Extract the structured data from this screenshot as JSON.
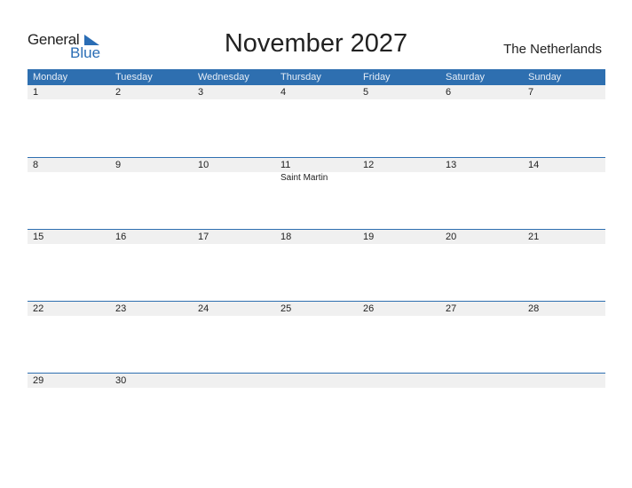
{
  "logo": {
    "general": "General",
    "blue": "Blue"
  },
  "title": "November 2027",
  "country": "The Netherlands",
  "days": [
    "Monday",
    "Tuesday",
    "Wednesday",
    "Thursday",
    "Friday",
    "Saturday",
    "Sunday"
  ],
  "weeks": [
    {
      "dates": [
        "1",
        "2",
        "3",
        "4",
        "5",
        "6",
        "7"
      ],
      "events": [
        "",
        "",
        "",
        "",
        "",
        "",
        ""
      ]
    },
    {
      "dates": [
        "8",
        "9",
        "10",
        "11",
        "12",
        "13",
        "14"
      ],
      "events": [
        "",
        "",
        "",
        "Saint Martin",
        "",
        "",
        ""
      ]
    },
    {
      "dates": [
        "15",
        "16",
        "17",
        "18",
        "19",
        "20",
        "21"
      ],
      "events": [
        "",
        "",
        "",
        "",
        "",
        "",
        ""
      ]
    },
    {
      "dates": [
        "22",
        "23",
        "24",
        "25",
        "26",
        "27",
        "28"
      ],
      "events": [
        "",
        "",
        "",
        "",
        "",
        "",
        ""
      ]
    },
    {
      "dates": [
        "29",
        "30",
        "",
        "",
        "",
        "",
        ""
      ],
      "events": [
        "",
        "",
        "",
        "",
        "",
        "",
        ""
      ]
    }
  ],
  "colors": {
    "accent": "#2e6fb0",
    "row_bg": "#f0f0f0"
  }
}
